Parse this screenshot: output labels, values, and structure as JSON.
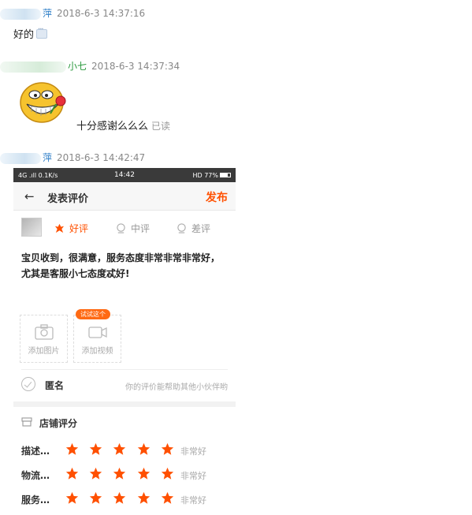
{
  "chat": {
    "messages": [
      {
        "sender": "萍",
        "time": "2018-6-3 14:37:16",
        "text": "好的"
      },
      {
        "sender": "小七",
        "time": "2018-6-3 14:37:34",
        "text": "十分感谢么么么",
        "status": "已读"
      },
      {
        "sender": "萍",
        "time": "2018-6-3 14:42:47"
      }
    ]
  },
  "phone": {
    "statusbar": {
      "left": "4G .ıll  0.1K/s",
      "time": "14:42",
      "right": "HD  77%"
    },
    "topbar": {
      "back": "←",
      "title": "发表评价",
      "publish": "发布"
    },
    "rating_tabs": [
      "好评",
      "中评",
      "差评"
    ],
    "review_text": "宝贝收到，很满意，服务态度非常非常非常好，尤其是客服小七态度忒好!",
    "upload": {
      "image_label": "添加图片",
      "video_label": "添加视频",
      "try_tag": "试试这个"
    },
    "anonymous": {
      "label": "匿名",
      "hint": "你的评价能帮助其他小伙伴哟"
    },
    "shop_rating": {
      "title": "店铺评分",
      "rows": [
        {
          "label": "描述…",
          "value": "非常好",
          "stars": 5
        },
        {
          "label": "物流…",
          "value": "非常好",
          "stars": 5
        },
        {
          "label": "服务…",
          "value": "非常好",
          "stars": 5
        }
      ]
    }
  },
  "colors": {
    "accent": "#ff5000",
    "link_blue": "#2f7fc8",
    "name_green": "#2c9a3f",
    "star": "#ff5000"
  },
  "icons": [
    "image-placeholder-icon",
    "camera-icon",
    "video-icon",
    "check-circle-icon",
    "shop-icon",
    "star-icon",
    "flower-icon",
    "back-arrow-icon",
    "emoji-icon"
  ]
}
